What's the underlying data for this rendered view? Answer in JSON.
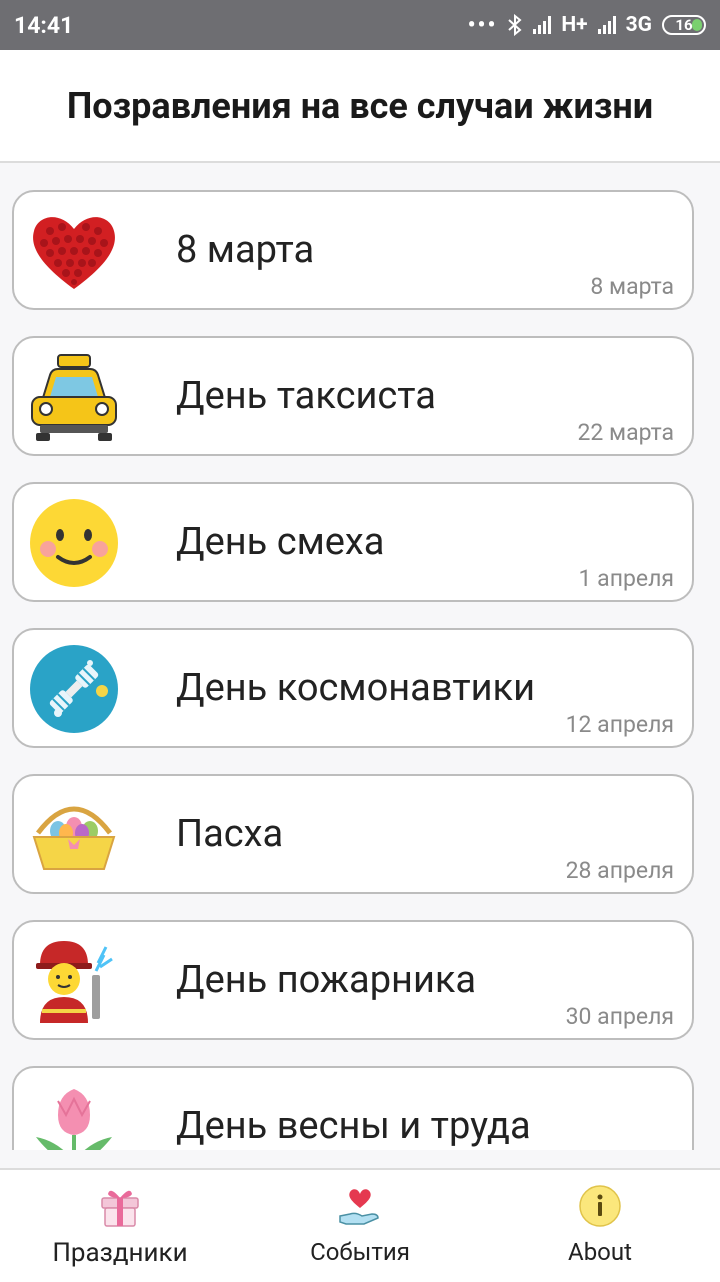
{
  "status_bar": {
    "time": "14:41",
    "dots": "•••",
    "network1": "H+",
    "network2": "3G",
    "battery": "16"
  },
  "header": {
    "title": "Позравления на все случаи жизни"
  },
  "holidays": [
    {
      "title": "8 марта",
      "date": "8 марта",
      "icon": "heart-of-roses-icon"
    },
    {
      "title": "День таксиста",
      "date": "22 марта",
      "icon": "taxi-icon"
    },
    {
      "title": "День смеха",
      "date": "1 апреля",
      "icon": "smiley-icon"
    },
    {
      "title": "День космонавтики",
      "date": "12 апреля",
      "icon": "satellite-icon"
    },
    {
      "title": "Пасха",
      "date": "28 апреля",
      "icon": "easter-basket-icon"
    },
    {
      "title": "День пожарника",
      "date": "30 апреля",
      "icon": "firefighter-icon"
    },
    {
      "title": "День весны и труда",
      "date": "",
      "icon": "tulip-icon"
    }
  ],
  "bottom_nav": {
    "items": [
      {
        "label": "Праздники",
        "icon": "gift-icon",
        "active": true
      },
      {
        "label": "События",
        "icon": "heart-hand-icon",
        "active": false
      },
      {
        "label": "About",
        "icon": "info-icon",
        "active": false
      }
    ]
  }
}
